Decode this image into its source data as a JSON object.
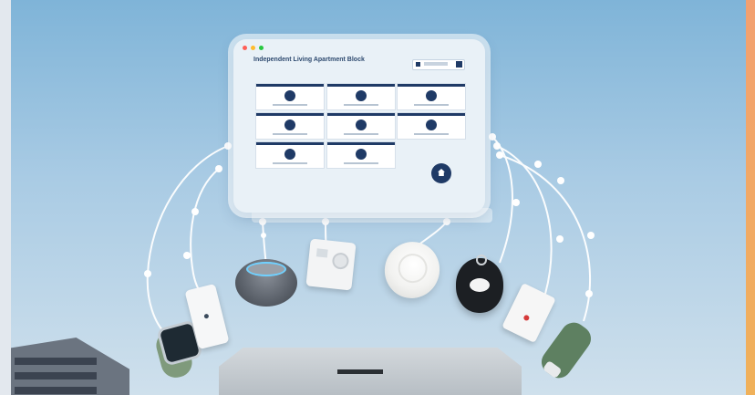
{
  "screen": {
    "title": "Independent Living Apartment Block",
    "window_dot_colors": [
      "#ff5f57",
      "#febc2e",
      "#28c840"
    ]
  },
  "colors": {
    "brand": "#1f3a66",
    "connection_line": "#ffffff"
  },
  "devices": [
    "smartwatch-icon",
    "wall-button-icon",
    "smart-speaker-icon",
    "thermostat-icon",
    "smoke-detector-icon",
    "emergency-pendant-icon",
    "door-sensor-icon",
    "key-fob-icon"
  ]
}
